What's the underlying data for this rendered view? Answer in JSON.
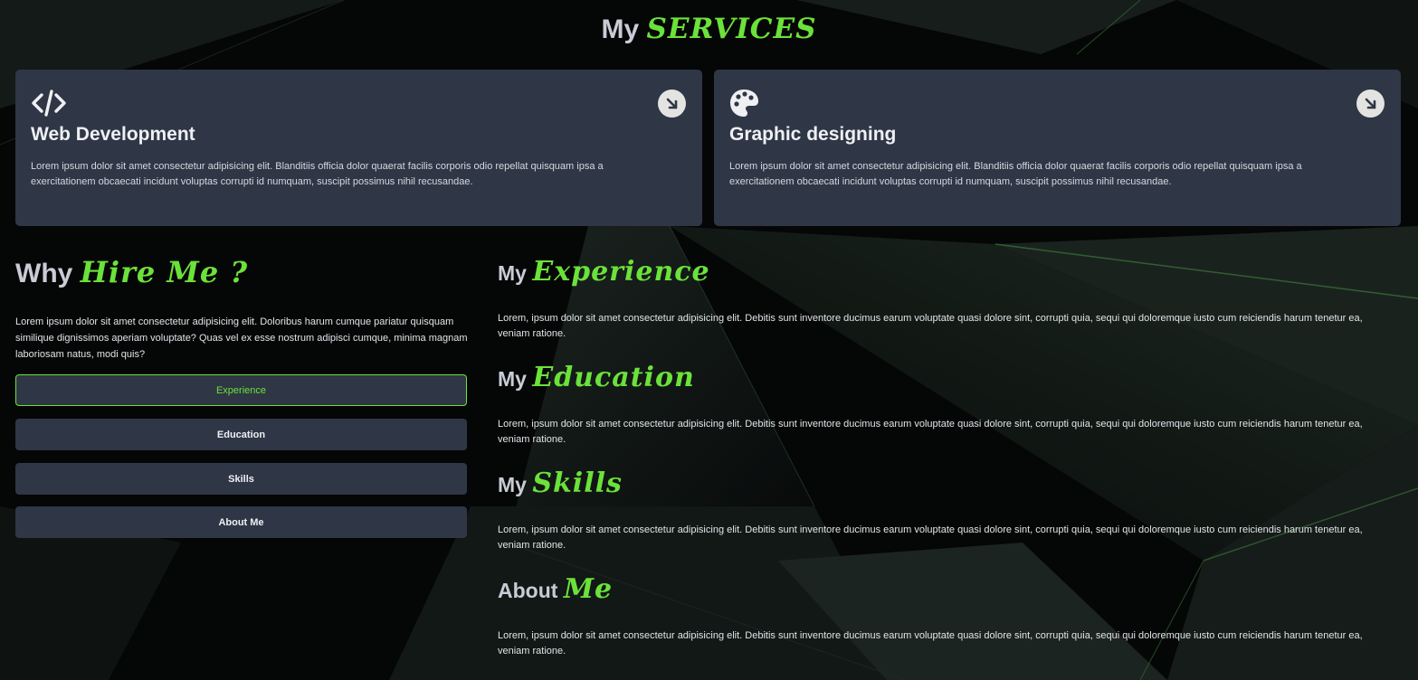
{
  "services": {
    "title_plain": "My",
    "title_accent": "SERVICES",
    "cards": [
      {
        "icon": "code-icon",
        "title": "Web Development",
        "text": "Lorem ipsum dolor sit amet consectetur adipisicing elit. Blanditiis officia dolor quaerat facilis corporis odio repellat quisquam ipsa a exercitationem obcaecati incidunt voluptas corrupti id numquam, suscipit possimus nihil recusandae."
      },
      {
        "icon": "palette-icon",
        "title": "Graphic designing",
        "text": "Lorem ipsum dolor sit amet consectetur adipisicing elit. Blanditiis officia dolor quaerat facilis corporis odio repellat quisquam ipsa a exercitationem obcaecati incidunt voluptas corrupti id numquam, suscipit possimus nihil recusandae."
      }
    ]
  },
  "why": {
    "title_plain": "Why",
    "title_accent": "Hire Me ?",
    "text": "Lorem ipsum dolor sit amet consectetur adipisicing elit. Doloribus harum cumque pariatur quisquam similique dignissimos aperiam voluptate? Quas vel ex esse nostrum adipisci cumque, minima magnam laboriosam natus, modi quis?",
    "tabs": [
      {
        "label": "Experience",
        "active": true
      },
      {
        "label": "Education",
        "active": false
      },
      {
        "label": "Skills",
        "active": false
      },
      {
        "label": "About Me",
        "active": false
      }
    ]
  },
  "sections": [
    {
      "title_plain": "My",
      "title_accent": "Experience",
      "text": "Lorem, ipsum dolor sit amet consectetur adipisicing elit. Debitis sunt inventore ducimus earum voluptate quasi dolore sint, corrupti quia, sequi qui doloremque iusto cum reiciendis harum tenetur ea, veniam ratione."
    },
    {
      "title_plain": "My",
      "title_accent": "Education",
      "text": "Lorem, ipsum dolor sit amet consectetur adipisicing elit. Debitis sunt inventore ducimus earum voluptate quasi dolore sint, corrupti quia, sequi qui doloremque iusto cum reiciendis harum tenetur ea, veniam ratione."
    },
    {
      "title_plain": "My",
      "title_accent": "Skills",
      "text": "Lorem, ipsum dolor sit amet consectetur adipisicing elit. Debitis sunt inventore ducimus earum voluptate quasi dolore sint, corrupti quia, sequi qui doloremque iusto cum reiciendis harum tenetur ea, veniam ratione."
    },
    {
      "title_plain": "About",
      "title_accent": "Me",
      "text": "Lorem, ipsum dolor sit amet consectetur adipisicing elit. Debitis sunt inventore ducimus earum voluptate quasi dolore sint, corrupti quia, sequi qui doloremque iusto cum reiciendis harum tenetur ea, veniam ratione."
    }
  ],
  "colors": {
    "accent": "#6be23a",
    "card_bg": "#2f3645",
    "page_bg": "#050606"
  },
  "icons": {
    "card_action": "arrow-down-right-icon"
  }
}
